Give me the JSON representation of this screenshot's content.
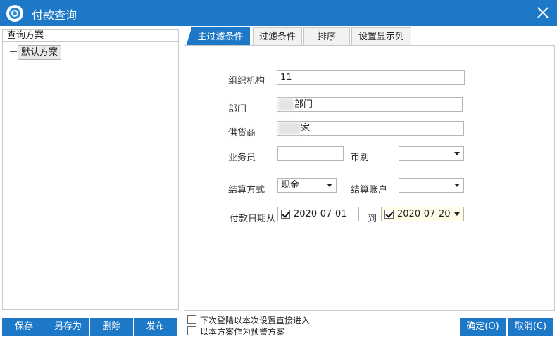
{
  "window": {
    "title": "付款查询"
  },
  "left": {
    "header": "查询方案",
    "tree_items": [
      "默认方案"
    ]
  },
  "tabs": [
    {
      "label": "主过滤条件",
      "active": true
    },
    {
      "label": "过滤条件",
      "active": false
    },
    {
      "label": "排序",
      "active": false
    },
    {
      "label": "设置显示列",
      "active": false
    }
  ],
  "form": {
    "org_label": "组织机构",
    "org_value": "11",
    "dept_label": "部门",
    "dept_value": "部门",
    "supplier_label": "供货商",
    "supplier_value": "家",
    "salesman_label": "业务员",
    "salesman_value": "",
    "currency_label": "币别",
    "currency_value": "",
    "settle_label": "结算方式",
    "settle_value": "现金",
    "account_label": "结算账户",
    "account_value": "",
    "date_from_label": "付款日期从",
    "date_from_value": "2020-07-01",
    "date_to_label": "到",
    "date_to_value": "2020-07-20"
  },
  "bottom": {
    "save_label": "保存",
    "save_as_label": "另存为",
    "delete_label": "删除",
    "publish_label": "发布",
    "option1_label": "下次登陆以本次设置直接进入",
    "option2_label": "以本方案作为预警方案",
    "ok_label": "确定(O)",
    "cancel_label": "取消(C)"
  },
  "colors": {
    "accent": "#1e78c8"
  }
}
